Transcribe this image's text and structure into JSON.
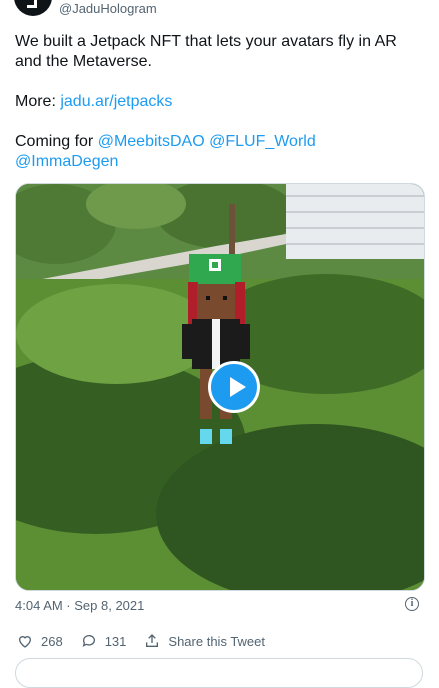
{
  "author": {
    "handle": "@JaduHologram"
  },
  "tweet": {
    "line1": "We built a Jetpack NFT that lets your avatars fly in AR and the Metaverse.",
    "more_label": "More: ",
    "more_link": "jadu.ar/jetpacks",
    "coming_label": "Coming for ",
    "mention1": "@MeebitsDAO",
    "mention2": "@FLUF_World",
    "mention3": "@ImmaDegen"
  },
  "media": {
    "type": "video",
    "play_icon": "play-icon"
  },
  "meta": {
    "timestamp": "4:04 AM · Sep 8, 2021",
    "info_icon": "info-icon"
  },
  "actions": {
    "likes": "268",
    "replies": "131",
    "share_label": "Share this Tweet"
  },
  "colors": {
    "link": "#1d9bf0",
    "text": "#0f1419",
    "muted": "#536471",
    "play_button": "#1d9bf0"
  }
}
